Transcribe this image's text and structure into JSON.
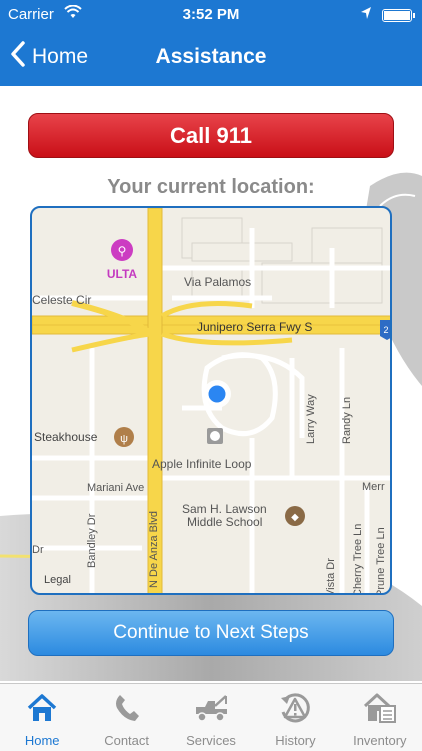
{
  "status": {
    "carrier": "Carrier",
    "time": "3:52 PM"
  },
  "nav": {
    "back_label": "Home",
    "title": "Assistance"
  },
  "call_button": "Call 911",
  "location_label": "Your current location:",
  "map": {
    "labels": {
      "ulta": "ULTA",
      "via_palamos": "Via Palamos",
      "celeste": "Celeste Cir",
      "freeway": "Junipero Serra Fwy S",
      "freeway_shield": "2",
      "steakhouse": "Steakhouse",
      "apple": "Apple Infinite Loop",
      "mariani": "Mariani Ave",
      "lawson1": "Sam H. Lawson",
      "lawson2": "Middle School",
      "de_anza": "N De Anza Blvd",
      "bandley": "Bandley Dr",
      "dr": "Dr",
      "larry": "Larry Way",
      "randy": "Randy Ln",
      "vista": "Vista Dr",
      "cherry": "Cherry Tree Ln",
      "prune": "Prune Tree Ln",
      "merr": "Merr",
      "legal": "Legal"
    }
  },
  "continue_button": "Continue to Next Steps",
  "tabs": [
    {
      "label": "Home",
      "active": true
    },
    {
      "label": "Contact",
      "active": false
    },
    {
      "label": "Services",
      "active": false
    },
    {
      "label": "History",
      "active": false
    },
    {
      "label": "Inventory",
      "active": false
    }
  ],
  "colors": {
    "brand_blue": "#1d78d2",
    "call_red": "#d3161e",
    "continue_blue": "#3c96e6",
    "location_dot": "#2b86f2"
  }
}
